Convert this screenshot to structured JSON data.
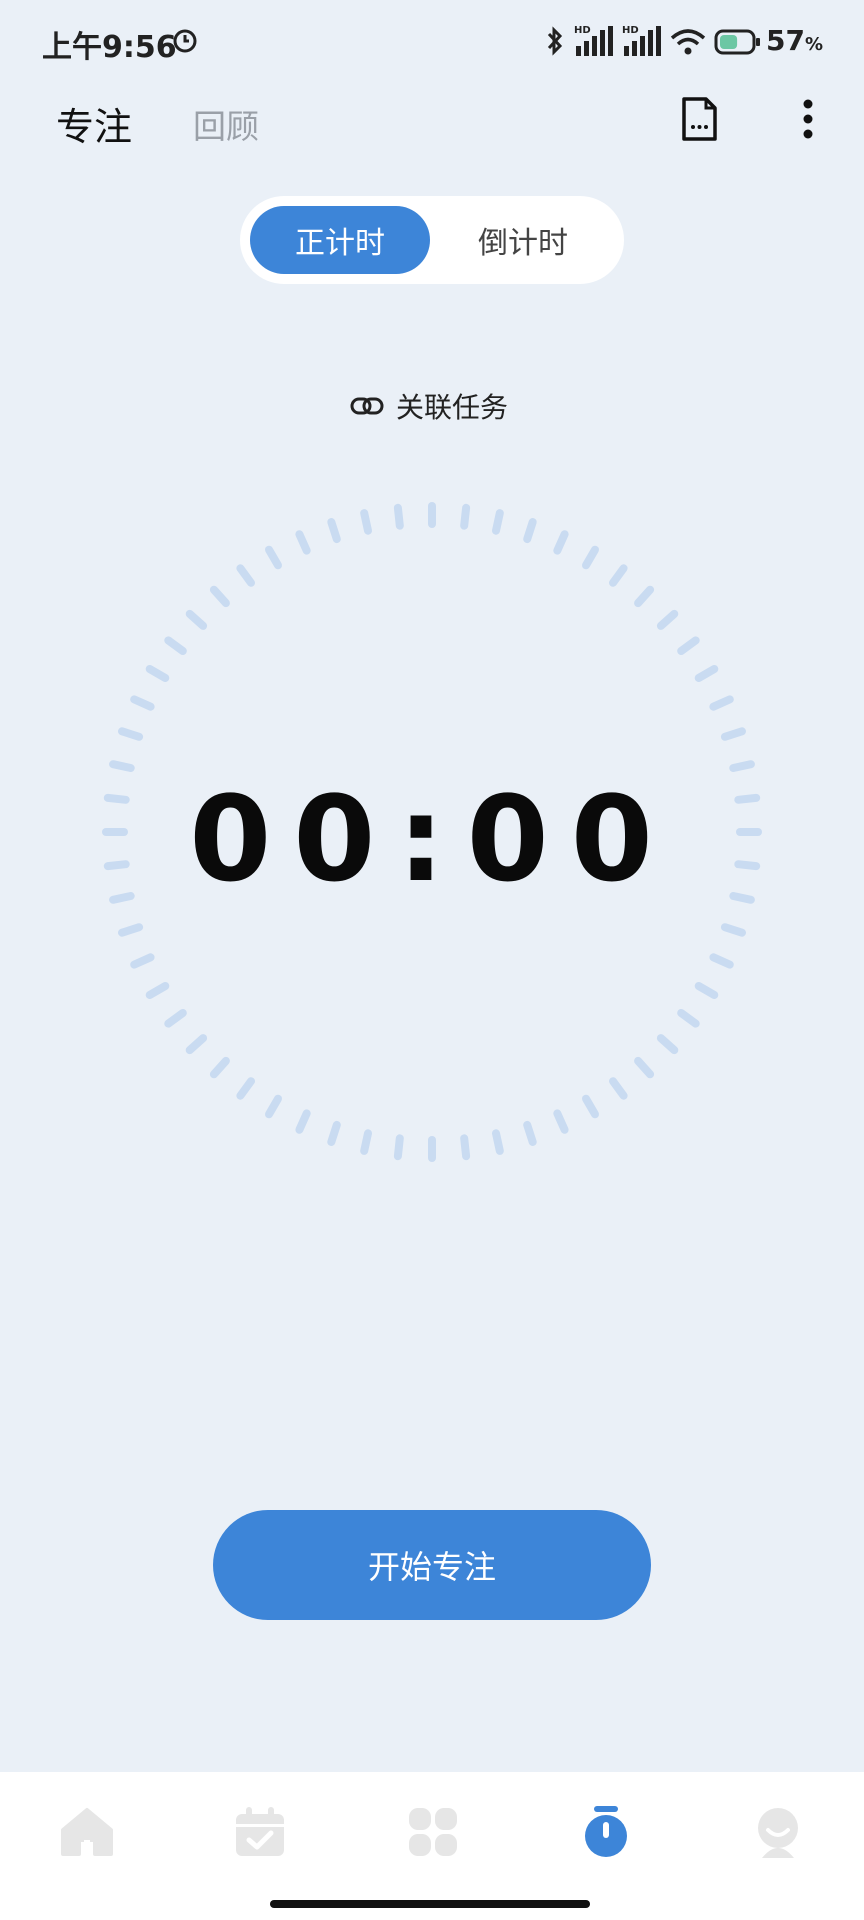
{
  "status_bar": {
    "time": "上午9:56",
    "battery_percent": "57",
    "battery_unit": "%",
    "battery_level": 0.57
  },
  "header": {
    "tab_focus": "专注",
    "tab_review": "回顾"
  },
  "mode_toggle": {
    "count_up": "正计时",
    "count_down": "倒计时",
    "selected": "正计时"
  },
  "link_task": {
    "label": "关联任务"
  },
  "timer": {
    "display": "00:00",
    "tick_count": 60
  },
  "start_button": {
    "label": "开始专注"
  },
  "bottom_nav": {
    "items": [
      {
        "icon": "home-icon"
      },
      {
        "icon": "calendar-check-icon"
      },
      {
        "icon": "apps-icon"
      },
      {
        "icon": "stopwatch-icon",
        "active": true
      },
      {
        "icon": "profile-icon"
      }
    ]
  },
  "colors": {
    "accent": "#3d85d8",
    "background": "#eaf0f7",
    "tick": "#c9dbf1",
    "nav_inactive": "#e6e6e6"
  }
}
